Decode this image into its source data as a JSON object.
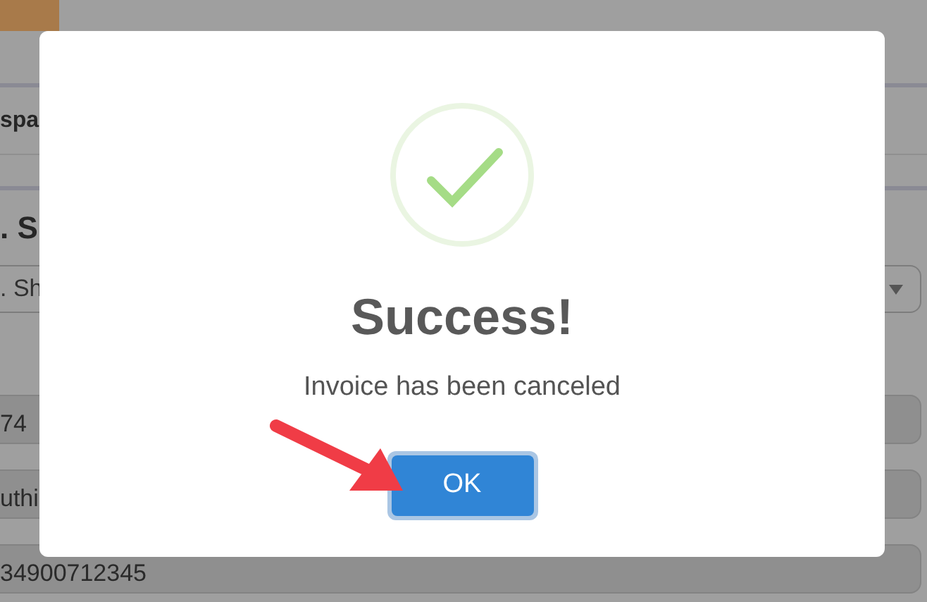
{
  "background": {
    "heading": "spa",
    "section_title": ". S",
    "select": {
      "value": ". Sh"
    },
    "fields": [
      {
        "value": "74"
      },
      {
        "value": "uthi"
      },
      {
        "value": "34900712345"
      }
    ]
  },
  "dialog": {
    "title": "Success!",
    "message": "Invoice has been canceled",
    "button": "OK"
  }
}
